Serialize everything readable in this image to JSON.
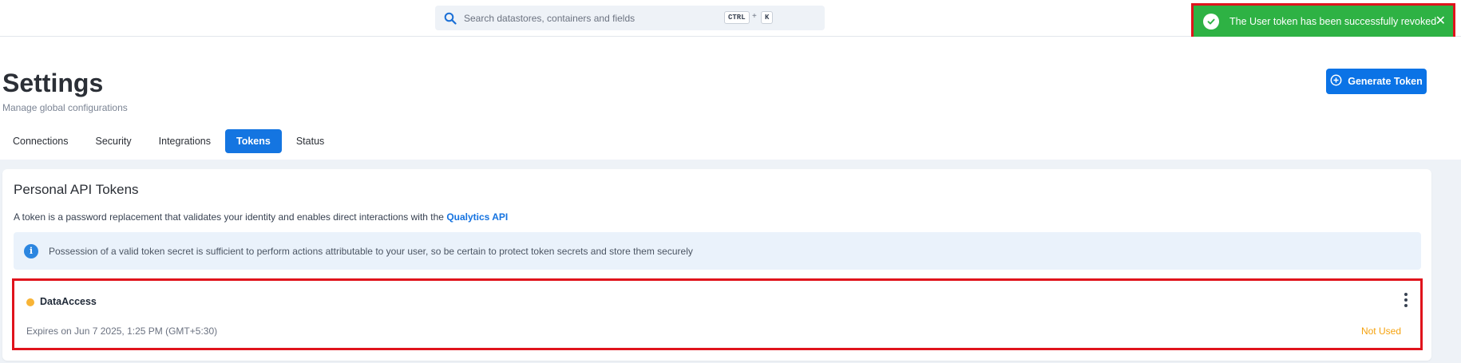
{
  "search": {
    "placeholder": "Search datastores, containers and fields",
    "shortcut_key1": "CTRL",
    "shortcut_plus": "+",
    "shortcut_key2": "K"
  },
  "toast": {
    "message": "The User token has been successfully revoked",
    "close_glyph": "✕",
    "color": "#2eb244"
  },
  "page": {
    "title": "Settings",
    "subtitle": "Manage global configurations",
    "generate_button": "Generate Token"
  },
  "tabs": [
    {
      "label": "Connections",
      "active": false
    },
    {
      "label": "Security",
      "active": false
    },
    {
      "label": "Integrations",
      "active": false
    },
    {
      "label": "Tokens",
      "active": true
    },
    {
      "label": "Status",
      "active": false
    }
  ],
  "card": {
    "title": "Personal API Tokens",
    "description": "A token is a password replacement that validates your identity and enables direct interactions with the",
    "api_link": "Qualytics API",
    "info_text": "Possession of a valid token secret is sufficient to perform actions attributable to your user, so be certain to protect token secrets and store them securely"
  },
  "token": {
    "name": "DataAccess",
    "expires": "Expires on Jun 7 2025, 1:25 PM (GMT+5:30)",
    "usage": "Not Used",
    "status_color": "#f8b436"
  },
  "colors": {
    "accent": "#0b73e6",
    "highlight_border": "#e0131c"
  }
}
